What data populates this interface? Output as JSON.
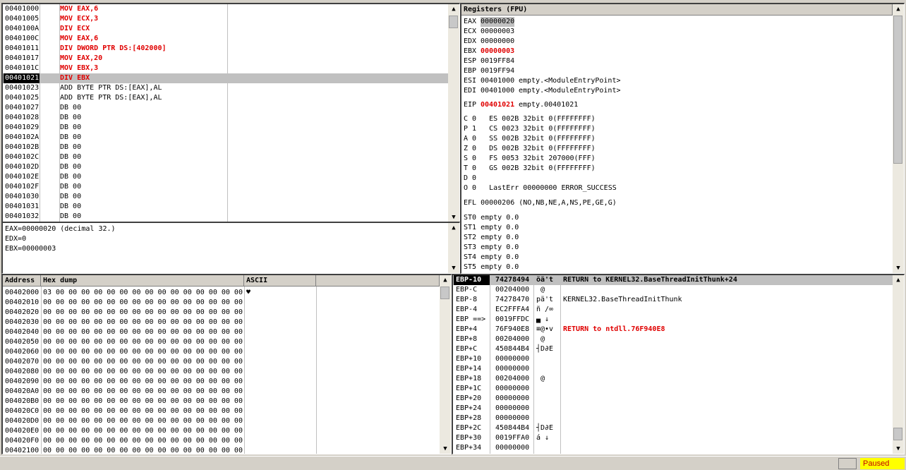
{
  "disasm": {
    "rows": [
      {
        "addr": "00401000",
        "instr": "MOV EAX,6",
        "style": "red"
      },
      {
        "addr": "00401005",
        "instr": "MOV ECX,3",
        "style": "red"
      },
      {
        "addr": "0040100A",
        "instr": "DIV ECX",
        "style": "red"
      },
      {
        "addr": "0040100C",
        "instr": "MOV EAX,6",
        "style": "red"
      },
      {
        "addr": "00401011",
        "instr": "DIV DWORD PTR DS:[402000]",
        "style": "red"
      },
      {
        "addr": "00401017",
        "instr": "MOV EAX,20",
        "style": "red"
      },
      {
        "addr": "0040101C",
        "instr": "MOV EBX,3",
        "style": "red"
      },
      {
        "addr": "00401021",
        "instr": "DIV EBX",
        "style": "red",
        "selected": true
      },
      {
        "addr": "00401023",
        "instr": "ADD BYTE PTR DS:[EAX],AL",
        "style": "black"
      },
      {
        "addr": "00401025",
        "instr": "ADD BYTE PTR DS:[EAX],AL",
        "style": "black"
      },
      {
        "addr": "00401027",
        "instr": "DB 00",
        "style": "gray"
      },
      {
        "addr": "00401028",
        "instr": "DB 00",
        "style": "gray"
      },
      {
        "addr": "00401029",
        "instr": "DB 00",
        "style": "gray"
      },
      {
        "addr": "0040102A",
        "instr": "DB 00",
        "style": "gray"
      },
      {
        "addr": "0040102B",
        "instr": "DB 00",
        "style": "gray"
      },
      {
        "addr": "0040102C",
        "instr": "DB 00",
        "style": "gray"
      },
      {
        "addr": "0040102D",
        "instr": "DB 00",
        "style": "gray"
      },
      {
        "addr": "0040102E",
        "instr": "DB 00",
        "style": "gray"
      },
      {
        "addr": "0040102F",
        "instr": "DB 00",
        "style": "gray"
      },
      {
        "addr": "00401030",
        "instr": "DB 00",
        "style": "gray"
      },
      {
        "addr": "00401031",
        "instr": "DB 00",
        "style": "gray"
      },
      {
        "addr": "00401032",
        "instr": "DB 00",
        "style": "gray"
      }
    ]
  },
  "info": {
    "lines": [
      "EAX=00000020 (decimal 32.)",
      "EDX=0",
      "EBX=00000003"
    ]
  },
  "registers": {
    "title": "Registers (FPU)",
    "general": [
      {
        "name": "EAX",
        "value": "00000020",
        "extra": "",
        "highlight": "box"
      },
      {
        "name": "ECX",
        "value": "00000003",
        "extra": ""
      },
      {
        "name": "EDX",
        "value": "00000000",
        "extra": ""
      },
      {
        "name": "EBX",
        "value": "00000003",
        "extra": "",
        "highlight": "red"
      },
      {
        "name": "ESP",
        "value": "0019FF84",
        "extra": ""
      },
      {
        "name": "EBP",
        "value": "0019FF94",
        "extra": ""
      },
      {
        "name": "ESI",
        "value": "00401000",
        "extra": "empty.<ModuleEntryPoint>"
      },
      {
        "name": "EDI",
        "value": "00401000",
        "extra": "empty.<ModuleEntryPoint>"
      }
    ],
    "eip": {
      "name": "EIP",
      "value": "00401021",
      "extra": "empty.00401021"
    },
    "flags": [
      "C 0   ES 002B 32bit 0(FFFFFFFF)",
      "P 1   CS 0023 32bit 0(FFFFFFFF)",
      "A 0   SS 002B 32bit 0(FFFFFFFF)",
      "Z 0   DS 002B 32bit 0(FFFFFFFF)",
      "S 0   FS 0053 32bit 207000(FFF)",
      "T 0   GS 002B 32bit 0(FFFFFFFF)",
      "D 0",
      "O 0   LastErr 00000000 ERROR_SUCCESS"
    ],
    "efl": "EFL 00000206 (NO,NB,NE,A,NS,PE,GE,G)",
    "fpu": [
      "ST0 empty 0.0",
      "ST1 empty 0.0",
      "ST2 empty 0.0",
      "ST3 empty 0.0",
      "ST4 empty 0.0",
      "ST5 empty 0.0"
    ]
  },
  "dump": {
    "headers": [
      "Address",
      "Hex dump",
      "ASCII"
    ],
    "rows": [
      {
        "addr": "00402000",
        "hex": "03 00 00 00 00 00 00 00 00 00 00 00 00 00 00 00",
        "ascii": "♥"
      },
      {
        "addr": "00402010",
        "hex": "00 00 00 00 00 00 00 00 00 00 00 00 00 00 00 00",
        "ascii": ""
      },
      {
        "addr": "00402020",
        "hex": "00 00 00 00 00 00 00 00 00 00 00 00 00 00 00 00",
        "ascii": ""
      },
      {
        "addr": "00402030",
        "hex": "00 00 00 00 00 00 00 00 00 00 00 00 00 00 00 00",
        "ascii": ""
      },
      {
        "addr": "00402040",
        "hex": "00 00 00 00 00 00 00 00 00 00 00 00 00 00 00 00",
        "ascii": ""
      },
      {
        "addr": "00402050",
        "hex": "00 00 00 00 00 00 00 00 00 00 00 00 00 00 00 00",
        "ascii": ""
      },
      {
        "addr": "00402060",
        "hex": "00 00 00 00 00 00 00 00 00 00 00 00 00 00 00 00",
        "ascii": ""
      },
      {
        "addr": "00402070",
        "hex": "00 00 00 00 00 00 00 00 00 00 00 00 00 00 00 00",
        "ascii": ""
      },
      {
        "addr": "00402080",
        "hex": "00 00 00 00 00 00 00 00 00 00 00 00 00 00 00 00",
        "ascii": ""
      },
      {
        "addr": "00402090",
        "hex": "00 00 00 00 00 00 00 00 00 00 00 00 00 00 00 00",
        "ascii": ""
      },
      {
        "addr": "004020A0",
        "hex": "00 00 00 00 00 00 00 00 00 00 00 00 00 00 00 00",
        "ascii": ""
      },
      {
        "addr": "004020B0",
        "hex": "00 00 00 00 00 00 00 00 00 00 00 00 00 00 00 00",
        "ascii": ""
      },
      {
        "addr": "004020C0",
        "hex": "00 00 00 00 00 00 00 00 00 00 00 00 00 00 00 00",
        "ascii": ""
      },
      {
        "addr": "004020D0",
        "hex": "00 00 00 00 00 00 00 00 00 00 00 00 00 00 00 00",
        "ascii": ""
      },
      {
        "addr": "004020E0",
        "hex": "00 00 00 00 00 00 00 00 00 00 00 00 00 00 00 00",
        "ascii": ""
      },
      {
        "addr": "004020F0",
        "hex": "00 00 00 00 00 00 00 00 00 00 00 00 00 00 00 00",
        "ascii": ""
      },
      {
        "addr": "00402100",
        "hex": "00 00 00 00 00 00 00 00 00 00 00 00 00 00 00 00",
        "ascii": ""
      }
    ]
  },
  "stack": {
    "rows": [
      {
        "off": "EBP-10",
        "val": "74278494",
        "ascii": "öä't",
        "comment": "RETURN to KERNEL32.BaseThreadInitThunk+24",
        "sel": true,
        "ctype": "bold"
      },
      {
        "off": "EBP-C",
        "val": "00204000",
        "ascii": " @",
        "comment": ""
      },
      {
        "off": "EBP-8",
        "val": "74278470",
        "ascii": "pä't",
        "comment": "KERNEL32.BaseThreadInitThunk"
      },
      {
        "off": "EBP-4",
        "val": "EC2FFFA4",
        "ascii": "ñ /∞",
        "comment": ""
      },
      {
        "off": "EBP ==>",
        "val": "0019FFDC",
        "ascii": "▄ ↓",
        "comment": ""
      },
      {
        "off": "EBP+4",
        "val": "76F940E8",
        "ascii": "≡@∙v",
        "comment": "RETURN to ntdll.76F940E8",
        "ctype": "red"
      },
      {
        "off": "EBP+8",
        "val": "00204000",
        "ascii": " @",
        "comment": ""
      },
      {
        "off": "EBP+C",
        "val": "450844B4",
        "ascii": "┤D∂E",
        "comment": ""
      },
      {
        "off": "EBP+10",
        "val": "00000000",
        "ascii": "",
        "comment": ""
      },
      {
        "off": "EBP+14",
        "val": "00000000",
        "ascii": "",
        "comment": ""
      },
      {
        "off": "EBP+18",
        "val": "00204000",
        "ascii": " @",
        "comment": ""
      },
      {
        "off": "EBP+1C",
        "val": "00000000",
        "ascii": "",
        "comment": ""
      },
      {
        "off": "EBP+20",
        "val": "00000000",
        "ascii": "",
        "comment": ""
      },
      {
        "off": "EBP+24",
        "val": "00000000",
        "ascii": "",
        "comment": ""
      },
      {
        "off": "EBP+28",
        "val": "00000000",
        "ascii": "",
        "comment": ""
      },
      {
        "off": "EBP+2C",
        "val": "450844B4",
        "ascii": "┤D∂E",
        "comment": ""
      },
      {
        "off": "EBP+30",
        "val": "0019FFA0",
        "ascii": "á ↓",
        "comment": ""
      },
      {
        "off": "EBP+34",
        "val": "00000000",
        "ascii": "",
        "comment": ""
      }
    ]
  },
  "status": {
    "state": "Paused"
  },
  "colors": {
    "accent_red": "#e00000",
    "selection": "#c0c0c0",
    "paused_bg": "#ffff00"
  }
}
